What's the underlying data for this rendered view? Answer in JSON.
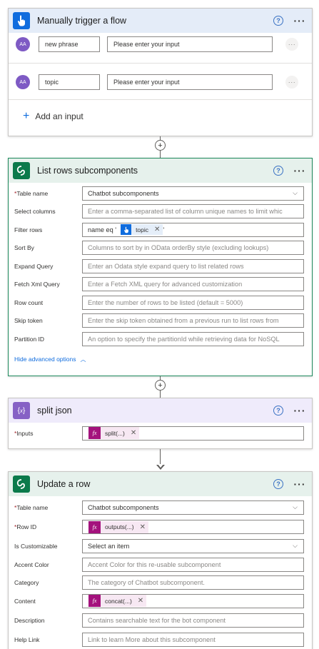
{
  "trigger": {
    "title": "Manually trigger a flow",
    "inputs": [
      {
        "avatar": "AA",
        "name": "new phrase",
        "placeholder": "Please enter your input"
      },
      {
        "avatar": "AA",
        "name": "topic",
        "placeholder": "Please enter your input"
      }
    ],
    "add_input_label": "Add an input"
  },
  "list_rows": {
    "title": "List rows subcomponents",
    "fields": {
      "table_name": {
        "label": "Table name",
        "value": "Chatbot subcomponents"
      },
      "select_columns": {
        "label": "Select columns",
        "placeholder": "Enter a comma-separated list of column unique names to limit whic"
      },
      "filter_rows": {
        "label": "Filter rows",
        "prefix": "name eq '",
        "token": "topic",
        "suffix": "'"
      },
      "sort_by": {
        "label": "Sort By",
        "placeholder": "Columns to sort by in OData orderBy style (excluding lookups)"
      },
      "expand_query": {
        "label": "Expand Query",
        "placeholder": "Enter an Odata style expand query to list related rows"
      },
      "fetch_xml": {
        "label": "Fetch Xml Query",
        "placeholder": "Enter a Fetch XML query for advanced customization"
      },
      "row_count": {
        "label": "Row count",
        "placeholder": "Enter the number of rows to be listed (default = 5000)"
      },
      "skip_token": {
        "label": "Skip token",
        "placeholder": "Enter the skip token obtained from a previous run to list rows from"
      },
      "partition_id": {
        "label": "Partition ID",
        "placeholder": "An option to specify the partitionId while retrieving data for NoSQL"
      }
    },
    "hide_advanced": "Hide advanced options"
  },
  "split_json": {
    "title": "split json",
    "inputs_label": "Inputs",
    "expression": "split(...)"
  },
  "update_row": {
    "title": "Update a row",
    "fields": {
      "table_name": {
        "label": "Table name",
        "value": "Chatbot subcomponents"
      },
      "row_id": {
        "label": "Row ID",
        "expression": "outputs(...)"
      },
      "is_customizable": {
        "label": "Is Customizable",
        "value": "Select an item"
      },
      "accent_color": {
        "label": "Accent Color",
        "placeholder": "Accent Color for this re-usable subcomponent"
      },
      "category": {
        "label": "Category",
        "placeholder": "The category of Chatbot subcomponent."
      },
      "content": {
        "label": "Content",
        "expression": "concat(...)"
      },
      "description": {
        "label": "Description",
        "placeholder": "Contains searchable text for the bot component"
      },
      "help_link": {
        "label": "Help Link",
        "placeholder": "Link to learn More about this subcomponent"
      }
    }
  },
  "common": {
    "help_glyph": "?",
    "more_glyph": "···",
    "required_mark": "*",
    "fx": "fx",
    "close": "✕",
    "chevron": "⌵",
    "plus": "+"
  },
  "colors": {
    "trigger_accent": "#0f6cde",
    "dataverse_accent": "#0b7a4b",
    "compose_accent": "#8661c5",
    "expression_accent": "#a4127d"
  }
}
